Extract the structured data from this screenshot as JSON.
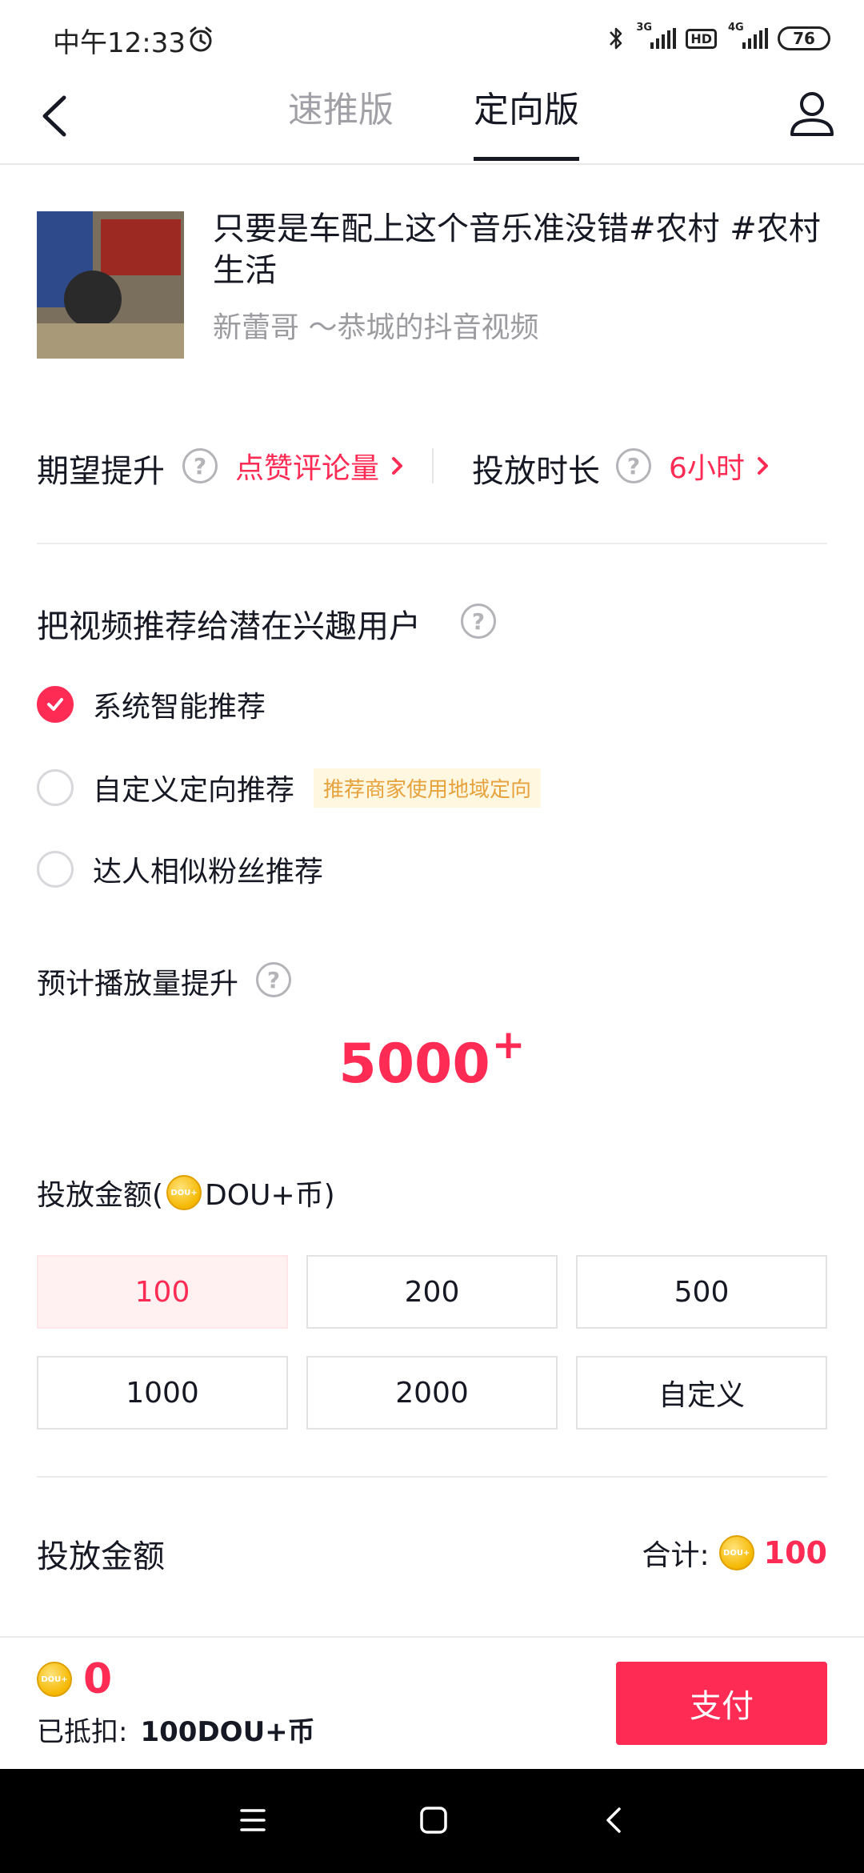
{
  "status_bar": {
    "time": "中午12:33",
    "signal_1_label": "3G",
    "hd_label": "HD",
    "signal_2_label": "4G",
    "battery": "76"
  },
  "header": {
    "tabs": [
      {
        "label": "速推版",
        "active": false
      },
      {
        "label": "定向版",
        "active": true
      }
    ]
  },
  "video": {
    "title": "只要是车配上这个音乐准没错#农村 #农村生活",
    "author": "新蕾哥 ～恭城的抖音视频"
  },
  "goals": {
    "expect_label": "期望提升",
    "expect_value": "点赞评论量",
    "duration_label": "投放时长",
    "duration_value": "6小时"
  },
  "audience": {
    "heading": "把视频推荐给潜在兴趣用户",
    "options": [
      {
        "label": "系统智能推荐",
        "checked": true
      },
      {
        "label": "自定义定向推荐",
        "checked": false,
        "tag": "推荐商家使用地域定向"
      },
      {
        "label": "达人相似粉丝推荐",
        "checked": false
      }
    ]
  },
  "estimate": {
    "label": "预计播放量提升",
    "value": "5000",
    "suffix": "+"
  },
  "amount": {
    "label_prefix": "投放金额(",
    "label_suffix": "DOU+币)",
    "coin_text": "DOU+",
    "options": [
      "100",
      "200",
      "500",
      "1000",
      "2000",
      "自定义"
    ],
    "selected": "100"
  },
  "summary": {
    "label": "投放金额",
    "total_label": "合计:",
    "total_value": "100"
  },
  "footer": {
    "balance": "0",
    "deducted_label": "已抵扣:",
    "deducted_value": "100DOU+币",
    "pay_label": "支付"
  },
  "colors": {
    "accent": "#fe2c55",
    "coin": "#f5b800",
    "tag_bg": "#fff7e0",
    "tag_text": "#e6a23c"
  }
}
